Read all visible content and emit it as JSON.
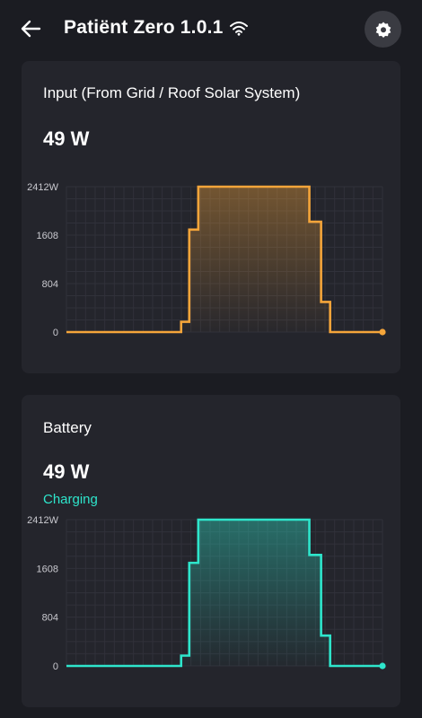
{
  "header": {
    "title": "Patiënt Zero 1.0.1",
    "back_icon": "arrow-left-icon",
    "wifi_icon": "wifi-icon",
    "settings_icon": "gear-icon"
  },
  "input_card": {
    "title": "Input (From Grid / Roof Solar System)",
    "value": "49 W"
  },
  "battery_card": {
    "title": "Battery",
    "value": "49 W",
    "status": "Charging"
  },
  "colors": {
    "input_line": "#f5a53a",
    "battery_line": "#2ee6cc",
    "background": "#1b1c22",
    "card": "#24252c"
  },
  "chart_data": [
    {
      "type": "line",
      "ylim": [
        0,
        2412
      ],
      "yticks": [
        "0",
        "804",
        "1608",
        "2412W"
      ],
      "ytick_values": [
        0,
        804,
        1608,
        2412
      ],
      "x": [
        0,
        11.5,
        12.7,
        13.6,
        14.6,
        25.9,
        26.9,
        28.2,
        29.2,
        35
      ],
      "values": [
        0,
        0,
        170,
        1700,
        2412,
        2412,
        1830,
        500,
        0,
        0
      ],
      "step": true
    },
    {
      "type": "line",
      "ylim": [
        0,
        2412
      ],
      "yticks": [
        "0",
        "804",
        "1608",
        "2412W"
      ],
      "ytick_values": [
        0,
        804,
        1608,
        2412
      ],
      "x": [
        0,
        11.5,
        12.7,
        13.6,
        14.6,
        25.9,
        26.9,
        28.2,
        29.2,
        35
      ],
      "values": [
        0,
        0,
        170,
        1700,
        2412,
        2412,
        1830,
        500,
        0,
        0
      ],
      "step": true
    }
  ]
}
